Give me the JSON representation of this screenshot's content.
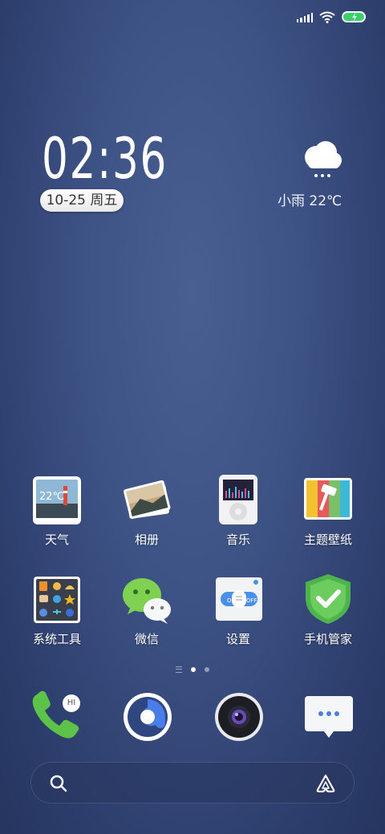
{
  "status_bar": {
    "signal_icon": "signal-icon",
    "wifi_icon": "wifi-icon",
    "battery_icon": "battery-charging-icon",
    "battery_color": "#3bd16a"
  },
  "clock_widget": {
    "time": "02:36",
    "date": "10-25 周五"
  },
  "weather_widget": {
    "icon": "rain-cloud-icon",
    "condition_temp": "小雨 22℃"
  },
  "apps": [
    {
      "label": "天气",
      "icon": "weather-app-icon",
      "icon_text": "22℃"
    },
    {
      "label": "相册",
      "icon": "gallery-icon"
    },
    {
      "label": "音乐",
      "icon": "music-icon"
    },
    {
      "label": "主题壁纸",
      "icon": "themes-icon"
    },
    {
      "label": "系统工具",
      "icon": "system-tools-folder-icon"
    },
    {
      "label": "微信",
      "icon": "wechat-icon"
    },
    {
      "label": "设置",
      "icon": "settings-icon"
    },
    {
      "label": "手机管家",
      "icon": "security-shield-icon"
    }
  ],
  "page_indicator": {
    "pages": 2,
    "active": 1
  },
  "dock": [
    {
      "name": "phone",
      "icon": "phone-icon",
      "badge": "HI"
    },
    {
      "name": "browser",
      "icon": "browser-icon"
    },
    {
      "name": "camera",
      "icon": "camera-icon"
    },
    {
      "name": "messages",
      "icon": "messages-icon"
    }
  ],
  "search_bar": {
    "search_icon": "search-icon",
    "assistant_icon": "assistant-icon"
  }
}
